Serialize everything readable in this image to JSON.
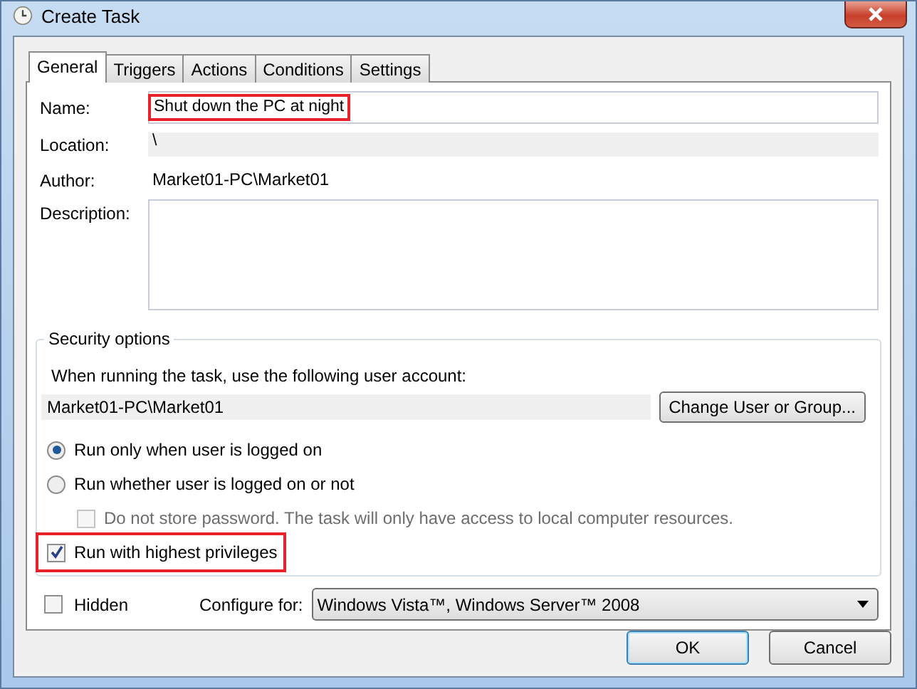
{
  "window": {
    "title": "Create Task"
  },
  "tabs": [
    {
      "label": "General",
      "selected": true
    },
    {
      "label": "Triggers",
      "selected": false
    },
    {
      "label": "Actions",
      "selected": false
    },
    {
      "label": "Conditions",
      "selected": false
    },
    {
      "label": "Settings",
      "selected": false
    }
  ],
  "general": {
    "name": {
      "label": "Name:",
      "value": "Shut down the PC at night",
      "highlighted": true
    },
    "location": {
      "label": "Location:",
      "value": "\\"
    },
    "author": {
      "label": "Author:",
      "value": "Market01-PC\\Market01"
    },
    "description": {
      "label": "Description:"
    }
  },
  "security_options": {
    "title": "Security options",
    "account_prompt": "When running the task, use the following user account:",
    "account": "Market01-PC\\Market01",
    "change_button": "Change User or Group...",
    "options": [
      {
        "kind": "radio",
        "label": "Run only when user is logged on",
        "selected": true,
        "disabled": false,
        "indent": false,
        "highlighted": false
      },
      {
        "kind": "radio",
        "label": "Run whether user is logged on or not",
        "selected": false,
        "disabled": false,
        "indent": false,
        "highlighted": false
      },
      {
        "kind": "checkbox",
        "label": "Do not store password.  The task will only have access to local computer resources.",
        "checked": false,
        "disabled": true,
        "indent": true,
        "highlighted": false
      },
      {
        "kind": "checkbox",
        "label": "Run with highest privileges",
        "checked": true,
        "disabled": false,
        "indent": false,
        "highlighted": true
      }
    ]
  },
  "hidden": {
    "label": "Hidden",
    "checked": false
  },
  "configure_for": {
    "label": "Configure for:",
    "value": "Windows Vista™, Windows Server™ 2008"
  },
  "buttons": [
    {
      "label": "OK",
      "default": true
    },
    {
      "label": "Cancel",
      "default": false
    }
  ]
}
